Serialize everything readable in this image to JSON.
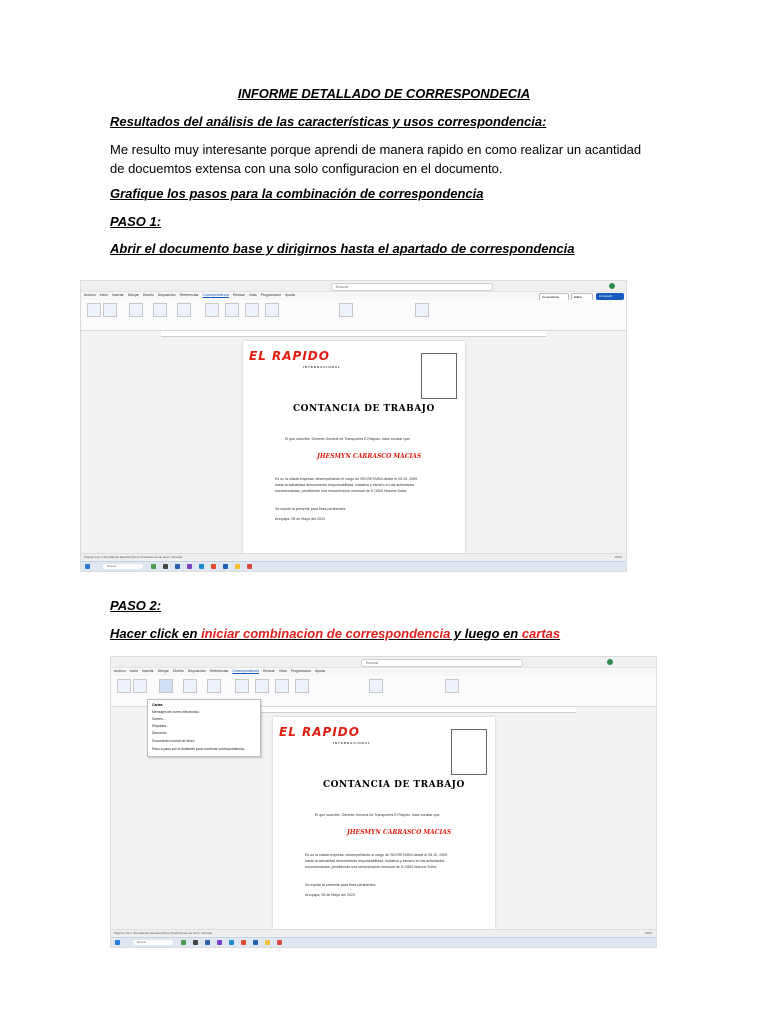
{
  "document": {
    "title": "INFORME DETALLADO DE CORRESPONDECIA",
    "heading_results": "Resultados del análisis de las características y usos correspondencia:",
    "paragraph_results": "Me resulto muy interesante porque aprendi de manera rapido en como realizar un acantidad de docuemtos extensa con una solo configuracion en el documento.",
    "heading_graph": "Grafique los pasos para la combinación de correspondencia",
    "step1_label": "PASO 1:",
    "step1_text": "Abrir el documento base y dirigirnos hasta el apartado de correspondencia",
    "step2_label": "PASO 2:",
    "step2_parts": {
      "a": "Hacer click en ",
      "b": "iniciar combinacion de correspondencia",
      "c": " y luego en ",
      "d": "cartas"
    }
  },
  "screenshot1": {
    "search": "Buscar",
    "menu": [
      "Archivo",
      "Inicio",
      "Insertar",
      "Dibujar",
      "Diseño",
      "Disposición",
      "Referencias",
      "Correspondencia",
      "Revisar",
      "Vista",
      "Programador",
      "Ayuda"
    ],
    "active_menu": "Correspondencia",
    "comments_btn": "Comentarios",
    "edit_btn": "Editar",
    "share_btn": "Compartir",
    "letter": {
      "logo": "EL RAPIDO",
      "logo_sub": "INTERNACIONAL",
      "title": "CONTANCIA DE TRABAJO",
      "intro": "El que suscribe, Gerente General de Transportes El Rápido, hace constar que:",
      "name": "JHESMYN CARRASCO MACIAS",
      "body1": "Es un la citada empresa, desempeñando el cargo de SECRETARIA desde el 05.10. 2009",
      "body2": "hasta la actualidad demostrando responsabilidad, iniciativa y esmero en las actividades",
      "body3": "encomendadas, percibiendo una remuneración mensual de S./1500 Nuevos Soles.",
      "closing": "Se expide la presente para fines pertinentes.",
      "date": "Arequipa, 05 de Mayo del 2024"
    },
    "status": "Página 1 de 1   93 palabras   Español (Perú)   Predicciones de texto: activado",
    "zoom": "100%",
    "taskbar_search": "Buscar"
  },
  "screenshot2": {
    "search": "Buscar",
    "menu": [
      "Archivo",
      "Inicio",
      "Insertar",
      "Dibujar",
      "Diseño",
      "Disposición",
      "Referencias",
      "Correspondencia",
      "Revisar",
      "Vista",
      "Programador",
      "Ayuda"
    ],
    "active_menu": "Correspondencia",
    "dropdown": [
      "Cartas",
      "Mensajes de correo electrónico",
      "Sobres...",
      "Etiquetas...",
      "Directorio",
      "Documento normal de Word",
      "Paso a paso por el Asistente para combinar correspondencia..."
    ],
    "letter": {
      "logo": "EL RAPIDO",
      "logo_sub": "INTERNACIONAL",
      "title": "CONTANCIA DE TRABAJO",
      "intro": "El que suscribe, Gerente General de Transportes El Rápido, hace constar que:",
      "name": "JHESMYN CARRASCO MACIAS",
      "body1": "Es un la citada empresa, desempeñando el cargo de SECRETARIA desde el 05.10. 2009",
      "body2": "hasta la actualidad demostrando responsabilidad, iniciativa y esmero en las actividades",
      "body3": "encomendadas, percibiendo una remuneración mensual de S./1500 Nuevos Soles.",
      "closing": "Se expide la presente para fines pertinentes.",
      "date": "Arequipa, 05 de Mayo del 2024"
    },
    "status": "Página 1 de 1   93 palabras   Español (Perú)   Predicciones de texto: activado",
    "zoom": "100%",
    "taskbar_search": "Buscar"
  },
  "colors": {
    "accent": "#185abd",
    "red": "#e0201b",
    "logo_red": "#e11d12"
  }
}
